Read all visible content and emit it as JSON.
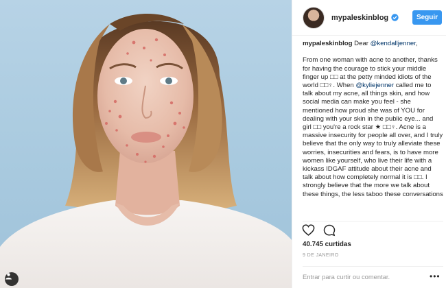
{
  "post": {
    "username": "mypaleskinblog",
    "follow_label": "Seguir",
    "caption": {
      "user": "mypaleskinblog",
      "intro": " Dear ",
      "intro_mention": "@kendalljenner",
      "intro_end": ",",
      "p1_a": "From one woman with acne to another, thanks for having the courage to stick your middle finger up □□ at the petty minded idiots of the world □□♀. When ",
      "p1_mention": "@kyliejenner",
      "p1_b": " called me to talk about my acne, all things skin, and how social media can make you feel - she mentioned how proud she was of YOU for dealing with your skin in the public eye... and girl □□ you're a rock star ★ □□♀. Acne is a massive insecurity for people all over, and I truly believe that the only way to truly alleviate these worries, insecurities and fears, is to have more women like yourself, who live their life with a kickass IDGAF attitude about their acne and talk about how completely normal it is □□. I strongly believe that the more we talk about these things, the less taboo these conversations"
    },
    "likes_text": "40.745 curtidas",
    "date_text": "9 DE JANEIRO",
    "comment_login_link": "Entrar",
    "comment_prompt": " para curtir ou comentar.",
    "more_glyph": "•••"
  },
  "icons": {
    "verified": "verified-badge-icon",
    "like": "heart-outline-icon",
    "comment": "comment-bubble-icon",
    "tag": "person-tag-icon",
    "more": "ellipsis-icon"
  },
  "colors": {
    "accent": "#3897f0",
    "text": "#262626",
    "muted": "#999999",
    "mention": "#003569",
    "border": "#efefef",
    "photo_background": "#a9cadf"
  }
}
